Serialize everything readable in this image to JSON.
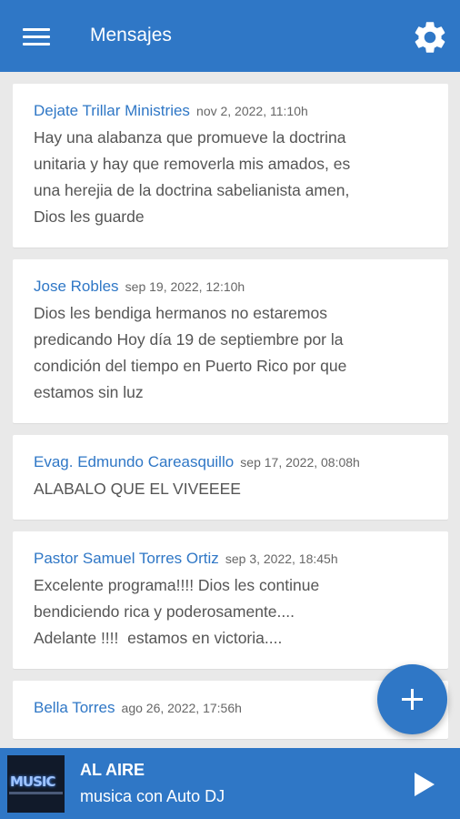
{
  "appbar": {
    "title": "Mensajes"
  },
  "messages": [
    {
      "author": "Dejate Trillar Ministries",
      "time": "nov 2, 2022, 11:10h",
      "text": "Hay una alabanza que promueve la doctrina\nunitaria y hay que removerla mis amados, es\nuna herejia de la doctrina sabelianista amen,\nDios les guarde"
    },
    {
      "author": "Jose Robles",
      "time": "sep 19, 2022, 12:10h",
      "text": "Dios les bendiga hermanos no estaremos\npredicando Hoy día 19 de septiembre por la\ncondición del tiempo en Puerto Rico por que\nestamos sin luz"
    },
    {
      "author": "Evag. Edmundo Careasquillo",
      "time": "sep 17, 2022, 08:08h",
      "text": "ALABALO QUE EL VIVEEEE"
    },
    {
      "author": "Pastor Samuel Torres Ortiz",
      "time": "sep 3, 2022, 18:45h",
      "text": "Excelente programa!!!! Dios les continue\nbendiciendo rica y poderosamente....\nAdelante !!!!  estamos en victoria...."
    },
    {
      "author": "Bella Torres",
      "time": "ago 26, 2022, 17:56h",
      "text": ""
    }
  ],
  "player": {
    "cover_text": "MUSIC",
    "title": "AL AIRE",
    "subtitle": "musica con Auto DJ"
  },
  "colors": {
    "accent": "#2f77c6",
    "author": "#2f77c6",
    "background": "#e9e9e9"
  },
  "icons": {
    "menu": "menu-icon",
    "settings": "gear-icon",
    "add": "plus-icon",
    "play": "play-icon"
  }
}
